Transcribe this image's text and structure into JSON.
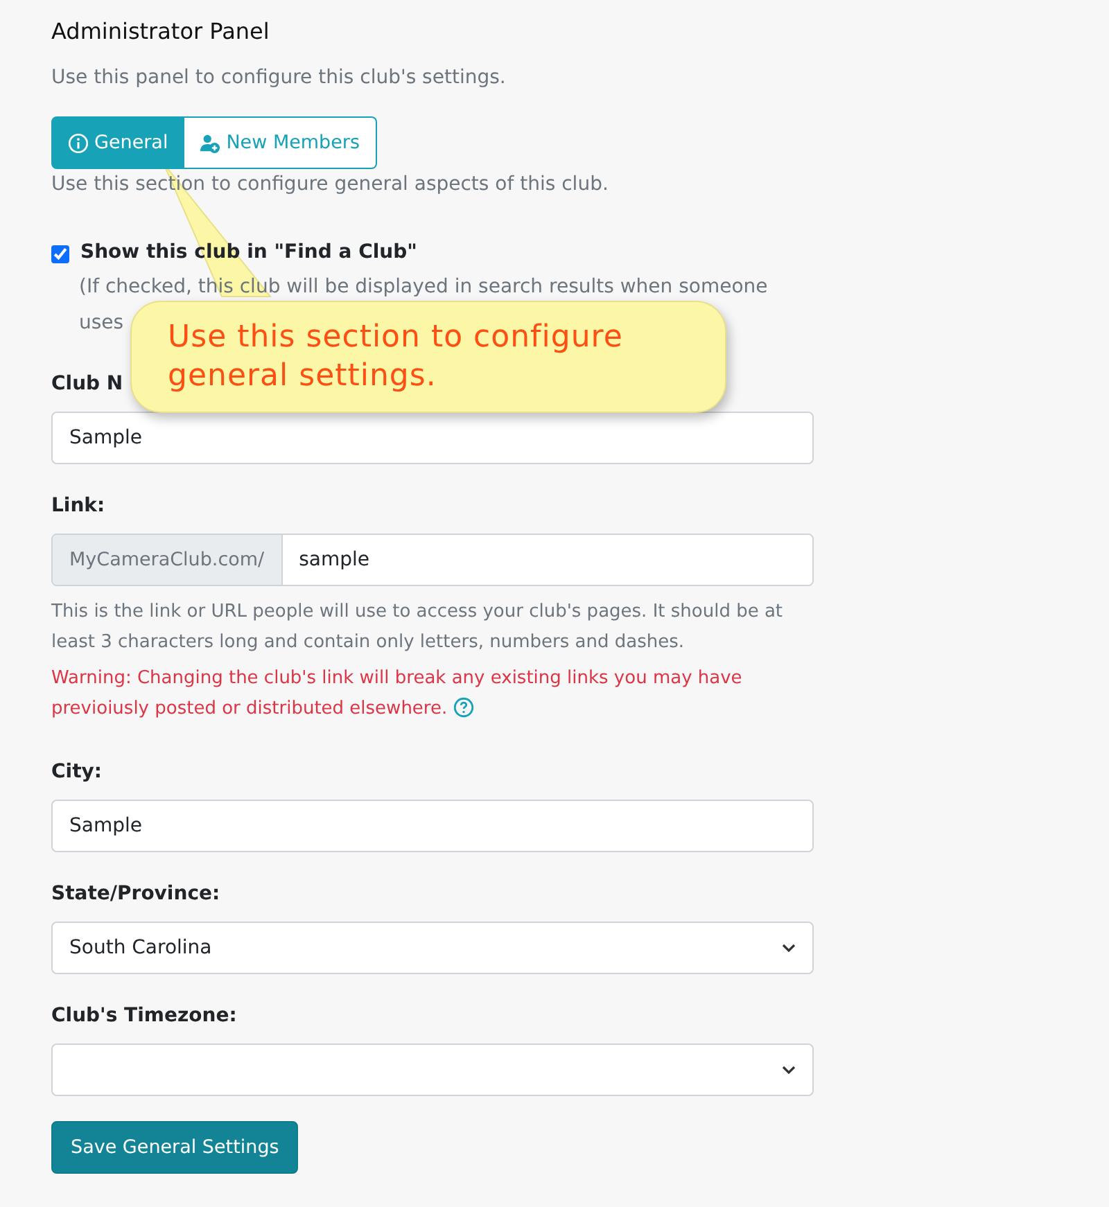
{
  "title": "Administrator Panel",
  "intro": "Use this panel to configure this club's settings.",
  "tabs": [
    {
      "label": "General",
      "selected": true
    },
    {
      "label": "New Members",
      "selected": false
    }
  ],
  "section_description": "Use this section to configure general aspects of this club.",
  "show_in_find": {
    "label": "Show this club in \"Find a Club\"",
    "checked": true,
    "hint_lines": [
      "(If checked, this club will be displayed in search results when someone",
      "uses"
    ]
  },
  "club_name": {
    "label": "Club N",
    "value": "Sample"
  },
  "link": {
    "label": "Link:",
    "prefix": "MyCameraClub.com/",
    "value": "sample",
    "help": "This is the link or URL people will use to access your club's pages. It should be at least 3 characters long and contain only letters, numbers and dashes.",
    "warning": "Warning: Changing the club's link will break any existing links you may have previoiusly posted or distributed elsewhere."
  },
  "city": {
    "label": "City:",
    "value": "Sample"
  },
  "state": {
    "label": "State/Province:",
    "value": "South Carolina"
  },
  "timezone": {
    "label": "Club's Timezone:"
  },
  "save_button": "Save General Settings",
  "callout": "Use this section to configure general settings."
}
